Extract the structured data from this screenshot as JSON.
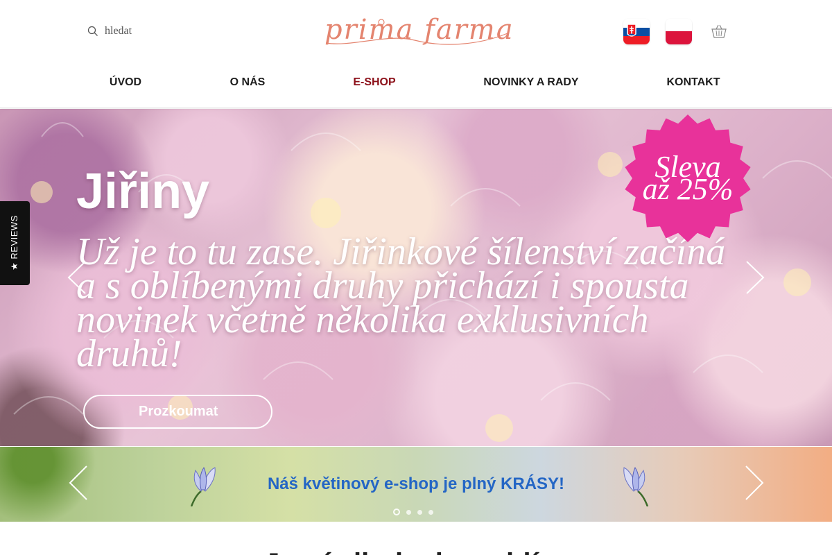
{
  "header": {
    "search": {
      "placeholder": "hledat",
      "icon": "search-icon"
    },
    "logo_text": "prima farma",
    "flags": [
      {
        "name": "slovak-flag",
        "colors": [
          "#ffffff",
          "#0b4ea2",
          "#ee1c25"
        ]
      },
      {
        "name": "polish-flag",
        "colors": [
          "#ffffff",
          "#dc143c"
        ]
      }
    ],
    "cart_icon": "basket-icon",
    "accent_color": "#e4846f"
  },
  "nav": {
    "items": [
      {
        "label": "ÚVOD",
        "active": false
      },
      {
        "label": "O NÁS",
        "active": false
      },
      {
        "label": "E-SHOP",
        "active": true
      },
      {
        "label": "NOVINKY A RADY",
        "active": false
      },
      {
        "label": "KONTAKT",
        "active": false
      }
    ],
    "active_color": "#8c1019"
  },
  "hero": {
    "title": "Jiřiny",
    "text": "Už je to tu zase. Jiřinkové šílenství začíná a s oblíbenými druhy přichází i spousta novinek včetně několika exklusivních druhů!",
    "button_label": "Prozkoumat",
    "badge": {
      "line1": "Sleva",
      "line2": "až 25%",
      "color": "#e8329a"
    },
    "prev_icon": "chevron-left-icon",
    "next_icon": "chevron-right-icon"
  },
  "reviews_tab": {
    "label": "REVIEWS",
    "icon": "star-icon"
  },
  "banner": {
    "text": "Náš květinový e-shop je plný KRÁSY!",
    "text_color": "#2466c5",
    "slides_total": 4,
    "active_slide": 1
  },
  "section": {
    "heading": "Jarní cibuloviny a hlízy"
  }
}
